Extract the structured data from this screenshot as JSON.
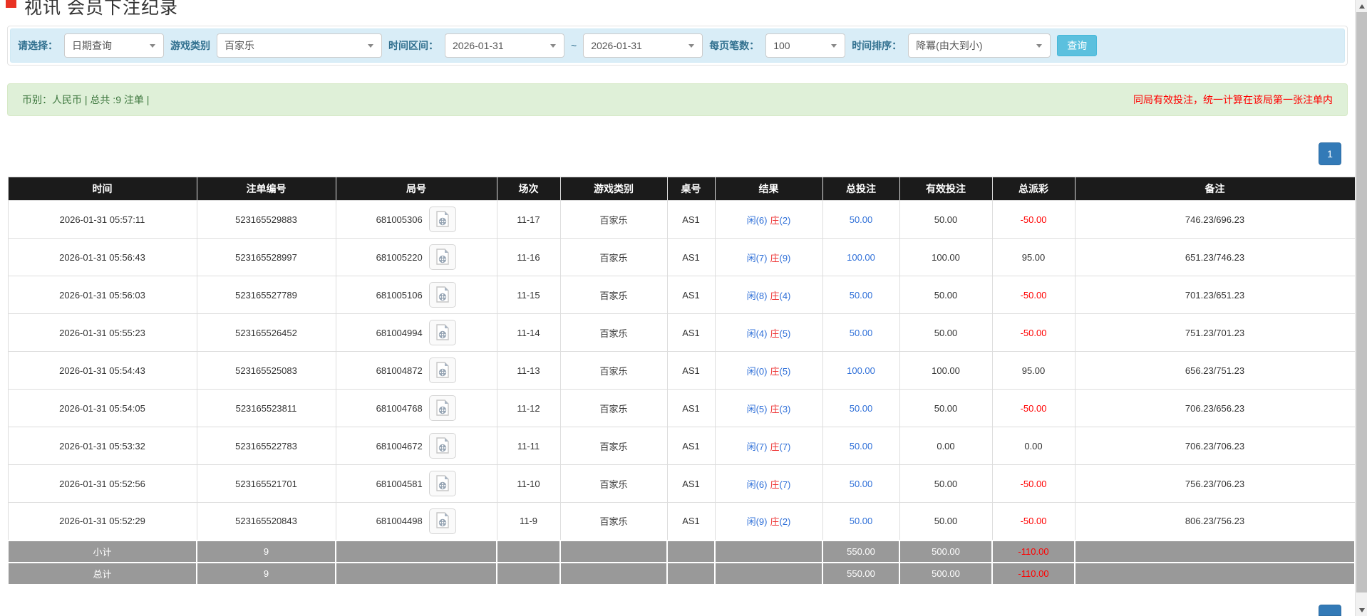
{
  "page": {
    "title": "视讯 会员下注纪录"
  },
  "colors": {
    "accent_blue": "#337ab7",
    "result_blue": "#2e6fd8",
    "negative_red": "#ff0000",
    "header_bg": "#1b1b1b",
    "summary_bg": "#999999",
    "filter_bg": "#d9edf7",
    "notice_bg": "#dff0d8",
    "search_button_bg": "#5bc0de"
  },
  "filter": {
    "select_label": "请选择：",
    "select_value": "日期查询",
    "game_label": "游戏类别",
    "game_value": "百家乐",
    "range_label": "时间区间：",
    "date_from": "2026-01-31",
    "tilde": "~",
    "date_to": "2026-01-31",
    "page_size_label": "每页笔数：",
    "page_size_value": "100",
    "sort_label": "时间排序：",
    "sort_value": "降冪(由大到小)",
    "search_button": "查询"
  },
  "summary_bar": {
    "left": "币别：人民币 | 总共 :9 注单 |",
    "notice": "同局有效投注，统一计算在该局第一张注单内"
  },
  "pagination": {
    "page": "1"
  },
  "icons": {
    "select_caret": "chevron-down-icon",
    "round_video": "video-file-icon"
  },
  "table": {
    "headers": [
      "时间",
      "注单编号",
      "局号",
      "场次",
      "游戏类别",
      "桌号",
      "结果",
      "总投注",
      "有效投注",
      "总派彩",
      "备注"
    ],
    "rows": [
      {
        "time": "2026-01-31 05:57:11",
        "bet_no": "523165529883",
        "round_no": "681005306",
        "session": "11-17",
        "game": "百家乐",
        "table_no": "AS1",
        "result": {
          "player": "闲(6)",
          "banker": "庄",
          "banker_score": "(2)"
        },
        "total_bet": "50.00",
        "valid_bet": "50.00",
        "payout": "-50.00",
        "remark": "746.23/696.23"
      },
      {
        "time": "2026-01-31 05:56:43",
        "bet_no": "523165528997",
        "round_no": "681005220",
        "session": "11-16",
        "game": "百家乐",
        "table_no": "AS1",
        "result": {
          "player": "闲(7)",
          "banker": "庄",
          "banker_score": "(9)"
        },
        "total_bet": "100.00",
        "valid_bet": "100.00",
        "payout": "95.00",
        "remark": "651.23/746.23"
      },
      {
        "time": "2026-01-31 05:56:03",
        "bet_no": "523165527789",
        "round_no": "681005106",
        "session": "11-15",
        "game": "百家乐",
        "table_no": "AS1",
        "result": {
          "player": "闲(8)",
          "banker": "庄",
          "banker_score": "(4)"
        },
        "total_bet": "50.00",
        "valid_bet": "50.00",
        "payout": "-50.00",
        "remark": "701.23/651.23"
      },
      {
        "time": "2026-01-31 05:55:23",
        "bet_no": "523165526452",
        "round_no": "681004994",
        "session": "11-14",
        "game": "百家乐",
        "table_no": "AS1",
        "result": {
          "player": "闲(4)",
          "banker": "庄",
          "banker_score": "(5)"
        },
        "total_bet": "50.00",
        "valid_bet": "50.00",
        "payout": "-50.00",
        "remark": "751.23/701.23"
      },
      {
        "time": "2026-01-31 05:54:43",
        "bet_no": "523165525083",
        "round_no": "681004872",
        "session": "11-13",
        "game": "百家乐",
        "table_no": "AS1",
        "result": {
          "player": "闲(0)",
          "banker": "庄",
          "banker_score": "(5)"
        },
        "total_bet": "100.00",
        "valid_bet": "100.00",
        "payout": "95.00",
        "remark": "656.23/751.23"
      },
      {
        "time": "2026-01-31 05:54:05",
        "bet_no": "523165523811",
        "round_no": "681004768",
        "session": "11-12",
        "game": "百家乐",
        "table_no": "AS1",
        "result": {
          "player": "闲(5)",
          "banker": "庄",
          "banker_score": "(3)"
        },
        "total_bet": "50.00",
        "valid_bet": "50.00",
        "payout": "-50.00",
        "remark": "706.23/656.23"
      },
      {
        "time": "2026-01-31 05:53:32",
        "bet_no": "523165522783",
        "round_no": "681004672",
        "session": "11-11",
        "game": "百家乐",
        "table_no": "AS1",
        "result": {
          "player": "闲(7)",
          "banker": "庄",
          "banker_score": "(7)"
        },
        "total_bet": "50.00",
        "valid_bet": "0.00",
        "payout": "0.00",
        "remark": "706.23/706.23"
      },
      {
        "time": "2026-01-31 05:52:56",
        "bet_no": "523165521701",
        "round_no": "681004581",
        "session": "11-10",
        "game": "百家乐",
        "table_no": "AS1",
        "result": {
          "player": "闲(6)",
          "banker": "庄",
          "banker_score": "(7)"
        },
        "total_bet": "50.00",
        "valid_bet": "50.00",
        "payout": "-50.00",
        "remark": "756.23/706.23"
      },
      {
        "time": "2026-01-31 05:52:29",
        "bet_no": "523165520843",
        "round_no": "681004498",
        "session": "11-9",
        "game": "百家乐",
        "table_no": "AS1",
        "result": {
          "player": "闲(9)",
          "banker": "庄",
          "banker_score": "(2)"
        },
        "total_bet": "50.00",
        "valid_bet": "50.00",
        "payout": "-50.00",
        "remark": "806.23/756.23"
      }
    ],
    "footer_rows": [
      {
        "label": "小计",
        "count": "9",
        "total_bet": "550.00",
        "valid_bet": "500.00",
        "payout": "-110.00"
      },
      {
        "label": "总计",
        "count": "9",
        "total_bet": "550.00",
        "valid_bet": "500.00",
        "payout": "-110.00"
      }
    ]
  }
}
